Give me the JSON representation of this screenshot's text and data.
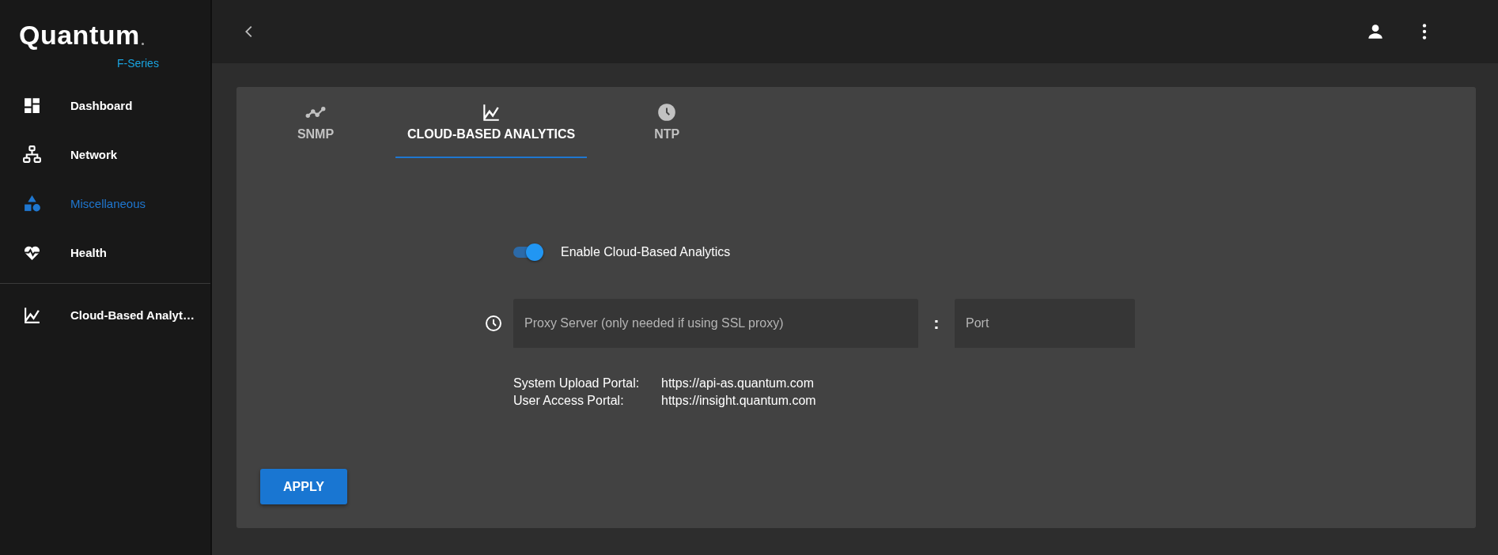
{
  "logo": {
    "name": "Quantum",
    "subtitle": "F-Series"
  },
  "sidebar": {
    "items": [
      {
        "label": "Dashboard",
        "selected": false
      },
      {
        "label": "Network",
        "selected": false
      },
      {
        "label": "Miscellaneous",
        "selected": true
      },
      {
        "label": "Health",
        "selected": false
      },
      {
        "label": "Cloud-Based Analyt…",
        "selected": false
      }
    ]
  },
  "tabs": [
    {
      "label": "SNMP",
      "selected": false
    },
    {
      "label": "CLOUD-BASED ANALYTICS",
      "selected": true
    },
    {
      "label": "NTP",
      "selected": false
    }
  ],
  "toggle": {
    "label": "Enable Cloud-Based Analytics",
    "on": true
  },
  "proxy": {
    "placeholder": "Proxy Server (only needed if using SSL proxy)",
    "separator": ":",
    "port_placeholder": "Port"
  },
  "portals": [
    {
      "label": "System Upload Portal:",
      "url": "https://api-as.quantum.com"
    },
    {
      "label": "User Access Portal:",
      "url": "https://insight.quantum.com"
    }
  ],
  "apply_button": "APPLY"
}
